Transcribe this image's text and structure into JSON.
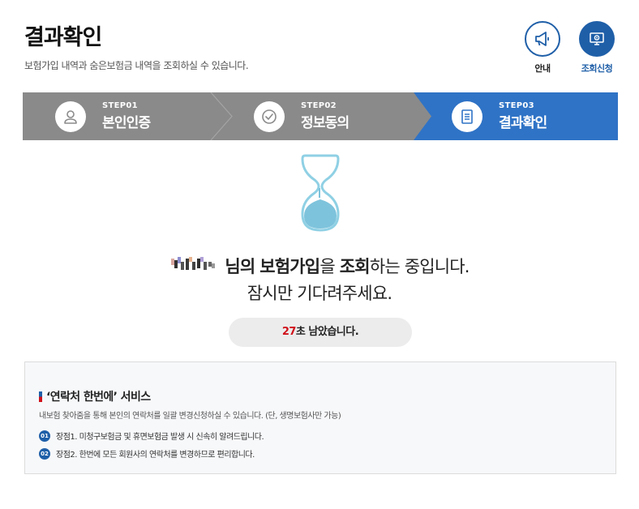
{
  "header": {
    "title": "결과확인",
    "subtitle": "보험가입 내역과 숨은보험금 내역을 조회하실 수 있습니다."
  },
  "top_buttons": {
    "guide": {
      "label": "안내",
      "icon": "megaphone-icon"
    },
    "apply": {
      "label": "조회신청",
      "icon": "monitor-icon"
    }
  },
  "steps": [
    {
      "no": "STEP01",
      "name": "본인인증",
      "icon": "user-icon",
      "active": false
    },
    {
      "no": "STEP02",
      "name": "정보동의",
      "icon": "check-circle-icon",
      "active": false
    },
    {
      "no": "STEP03",
      "name": "결과확인",
      "icon": "document-icon",
      "active": true
    }
  ],
  "message": {
    "name_suffix": "님의",
    "line1_parts": [
      "보험가입",
      "을",
      "조회",
      "하는 중입니다."
    ],
    "line2": "잠시만 기다려주세요."
  },
  "timer": {
    "seconds": "27",
    "suffix": "초 남았습니다."
  },
  "service": {
    "title": "‘연락처 한번에’ 서비스",
    "description": "내보험 찾아줌을 통해 본인의 연락처를 일괄 변경신청하실 수 있습니다. (단, 생명보험사만 가능)",
    "items": [
      {
        "num": "01",
        "text": "장점1. 미청구보험금 및 휴면보험금 발생 시 신속히 알려드립니다."
      },
      {
        "num": "02",
        "text": "장점2. 한번에 모든 회원사의 연락처를 변경하므로 편리합니다."
      }
    ]
  },
  "colors": {
    "primary": "#1f5fa8",
    "step_active": "#2f73c6",
    "step_inactive": "#8a8a8a",
    "timer_number": "#d0121b",
    "hourglass_fill": "#7ec3dc"
  }
}
